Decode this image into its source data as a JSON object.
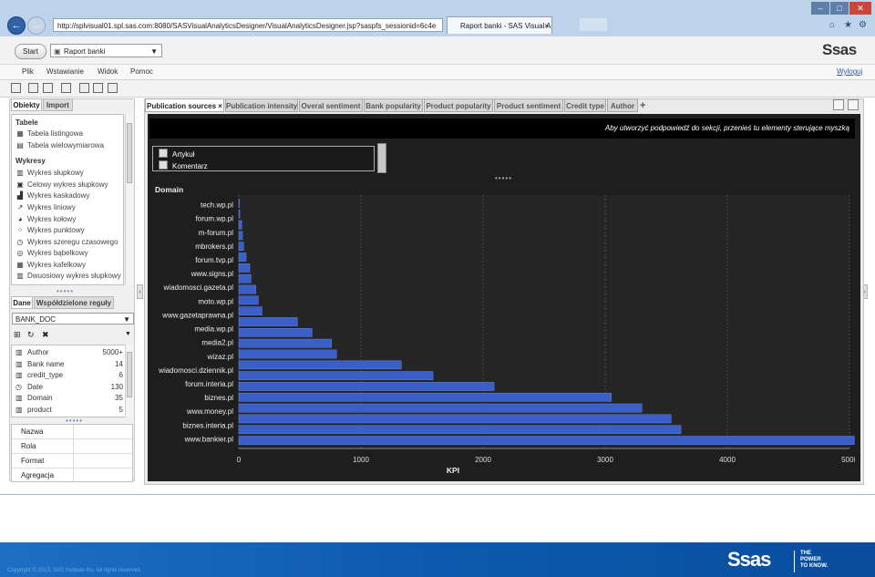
{
  "browser": {
    "url": "http://splvisual01.spl.sas.com:8080/SASVisualAnalyticsDesigner/VisualAnalyticsDesigner.jsp?saspfs_sessionid=6c4e",
    "tab_title": "Raport banki - SAS Visual A...",
    "tab_close": "×",
    "back_glyph": "←",
    "forward_glyph": "→",
    "window_buttons": [
      "–",
      "□",
      "✕"
    ],
    "right_icons": [
      "⌂",
      "★",
      "⚙"
    ]
  },
  "header": {
    "start_label": "Start",
    "report_name": "Raport banki",
    "logo": "Ssas"
  },
  "menu": {
    "items": [
      "Plik",
      "Wstawianie",
      "Widok",
      "Pomoc"
    ],
    "logout": "Wyloguj"
  },
  "left_panel": {
    "tabs": [
      "Obiekty",
      "Import"
    ],
    "tables_header": "Tabele",
    "tables": [
      {
        "label": "Tabela listingowa",
        "icon": "table-icon"
      },
      {
        "label": "Tabela wielowymiarowa",
        "icon": "crosstab-icon"
      }
    ],
    "charts_header": "Wykresy",
    "charts": [
      {
        "label": "Wykres słupkowy",
        "icon": "bar-chart-icon"
      },
      {
        "label": "Celowy wykres słupkowy",
        "icon": "target-bar-icon"
      },
      {
        "label": "Wykres kaskadowy",
        "icon": "waterfall-icon"
      },
      {
        "label": "Wykres liniowy",
        "icon": "line-chart-icon"
      },
      {
        "label": "Wykres kołowy",
        "icon": "pie-chart-icon"
      },
      {
        "label": "Wykres punktowy",
        "icon": "scatter-icon"
      },
      {
        "label": "Wykres szeregu czasowego",
        "icon": "time-series-icon"
      },
      {
        "label": "Wykres bąbelkowy",
        "icon": "bubble-icon"
      },
      {
        "label": "Wykres kafelkowy",
        "icon": "treemap-icon"
      },
      {
        "label": "Dwuosiowy wykres słupkowy",
        "icon": "dual-axis-icon"
      }
    ],
    "data_tabs": [
      "Dane",
      "Współdzielone reguły"
    ],
    "data_source": "BANK_DOC",
    "data_items": [
      {
        "label": "Author",
        "count": "5000+",
        "icon": "category-icon"
      },
      {
        "label": "Bank name",
        "count": "14",
        "icon": "category-icon"
      },
      {
        "label": "credit_type",
        "count": "6",
        "icon": "category-icon"
      },
      {
        "label": "Date",
        "count": "130",
        "icon": "date-icon"
      },
      {
        "label": "Domain",
        "count": "35",
        "icon": "category-icon"
      },
      {
        "label": "product",
        "count": "5",
        "icon": "category-icon"
      }
    ],
    "properties": [
      "Nazwa",
      "Rola",
      "Format",
      "Agregacja"
    ]
  },
  "report_tabs": [
    {
      "label": "Publication sources",
      "active": true,
      "close": "×"
    },
    {
      "label": "Publication intensity",
      "active": false
    },
    {
      "label": "Overal sentiment",
      "active": false
    },
    {
      "label": "Bank popularity",
      "active": false
    },
    {
      "label": "Product popularity",
      "active": false
    },
    {
      "label": "Product sentiment",
      "active": false
    },
    {
      "label": "Credit type",
      "active": false
    },
    {
      "label": "Author",
      "active": false
    }
  ],
  "add_tab": "+",
  "section_hint": "Aby utworzyć podpowiedź do sekcji, przenieś tu elementy sterujące myszką",
  "filter_items": [
    "Artykuł",
    "Komentarz"
  ],
  "chart_data": {
    "type": "bar",
    "orientation": "horizontal",
    "title": "Domain",
    "xlabel": "KPI",
    "ylabel": "Domain",
    "xlim": [
      0,
      5000
    ],
    "xticks": [
      0,
      1000,
      2000,
      3000,
      4000,
      5000
    ],
    "grid": true,
    "bar_color": "#3a5fc8",
    "categories": [
      "tech.wp.pl",
      "forum.wp.pl",
      "m-forum.pl",
      "mbrokers.pl",
      "forum.tvp.pl",
      "www.signs.pl",
      "wiadomosci.gazeta.pl",
      "moto.wp.pl",
      "www.gazetaprawna.pl",
      "media.wp.pl",
      "media2.pl",
      "wizaz.pl",
      "wiadomosci.dziennik.pl",
      "forum.interia.pl",
      "biznes.pl",
      "www.money.pl",
      "biznes.interia.pl",
      "www.bankier.pl"
    ],
    "values": [
      5,
      8,
      25,
      30,
      40,
      60,
      90,
      100,
      140,
      160,
      190,
      480,
      600,
      760,
      800,
      1330,
      1590,
      2090,
      3050,
      3300,
      3540,
      3620,
      5040
    ]
  },
  "footer": {
    "copyright": "Copyright © 2013, SAS Institute Inc. All rights reserved.",
    "logo": "Ssas",
    "tagline": "THE\nPOWER\nTO KNOW."
  },
  "colors": {
    "accent": "#2f62a8",
    "chart_bg": "#1e1e1e",
    "bar": "#3a5fc8",
    "footer": "#0c5aaf"
  }
}
